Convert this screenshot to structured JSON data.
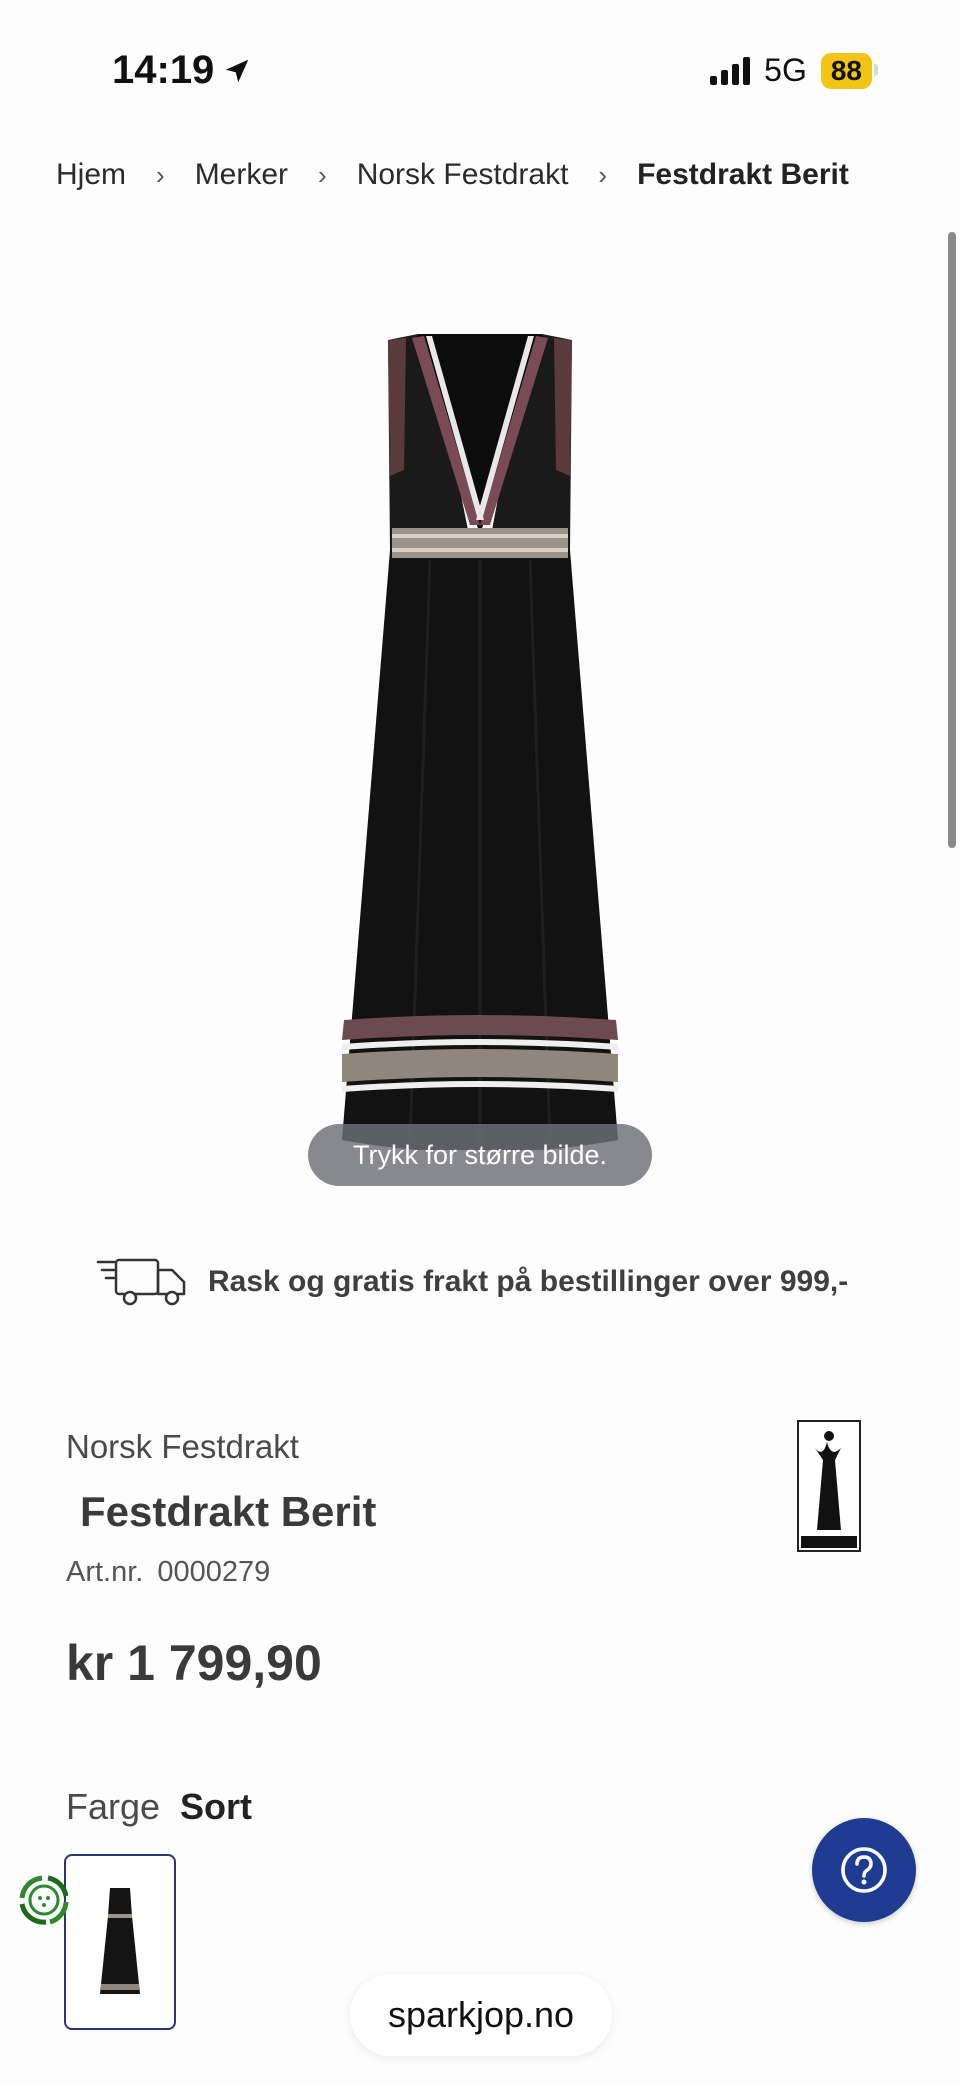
{
  "status_bar": {
    "time": "14:19",
    "network": "5G",
    "battery": "88"
  },
  "breadcrumb": {
    "items": [
      "Hjem",
      "Merker",
      "Norsk Festdrakt",
      "Festdrakt Berit"
    ]
  },
  "image": {
    "enlarge_hint": "Trykk for større bilde."
  },
  "shipping": {
    "text": "Rask og gratis frakt på bestillinger over 999,-"
  },
  "product": {
    "brand": "Norsk Festdrakt",
    "title": "Festdrakt Berit",
    "artnr_label": "Art.nr.",
    "artnr": "0000279",
    "price": "kr 1 799,90",
    "color_label": "Farge",
    "color_value": "Sort"
  },
  "browser": {
    "url": "sparkjop.no"
  },
  "colors": {
    "accent": "#1f3c92",
    "battery": "#f2c413",
    "swatch_border": "#26377a"
  }
}
